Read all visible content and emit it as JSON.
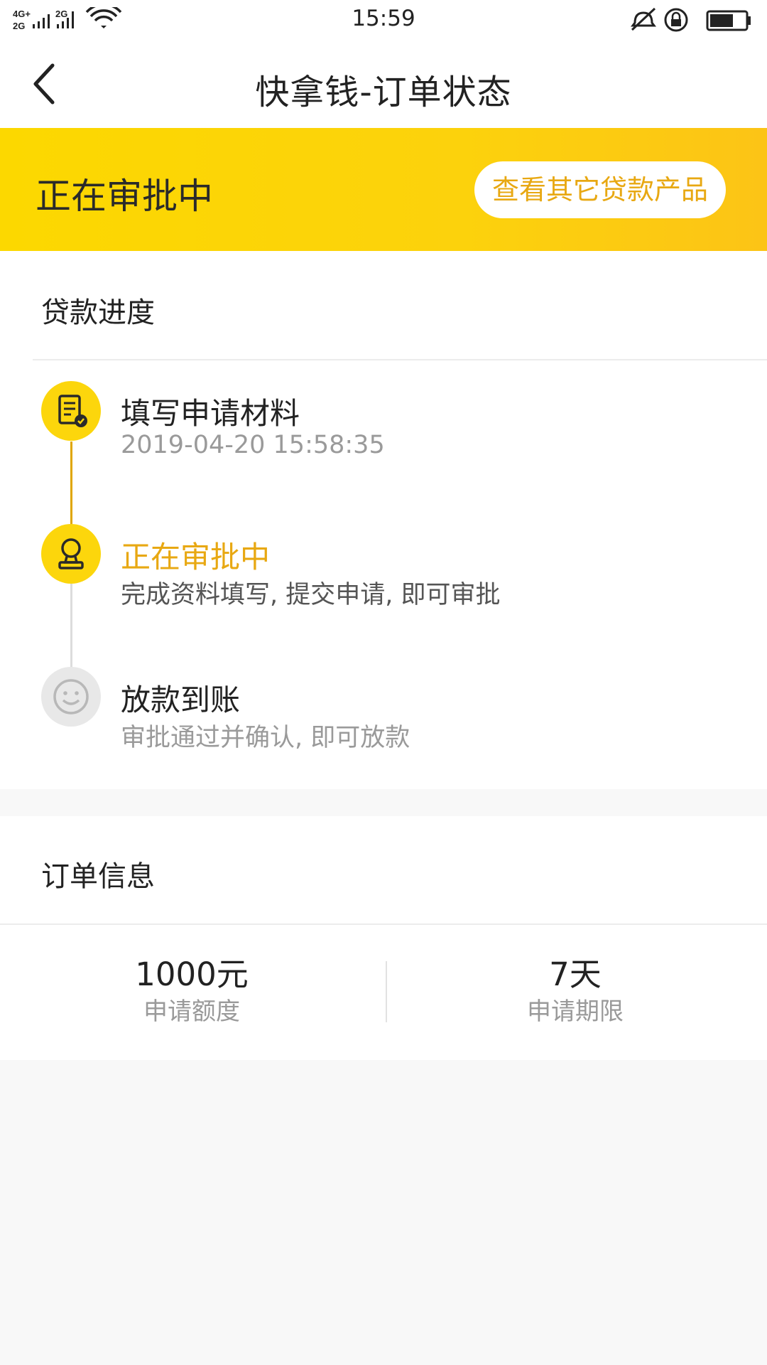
{
  "status_bar": {
    "network_top": "4G",
    "network_bottom": "2G",
    "network2": "2G",
    "time": "15:59",
    "icons": [
      "signal-icon",
      "wifi-icon",
      "mute-icon",
      "rotation-lock-icon",
      "battery-icon"
    ]
  },
  "nav": {
    "title": "快拿钱-订单状态",
    "back_icon": "chevron-left-icon"
  },
  "banner": {
    "status": "正在审批中",
    "button_label": "查看其它贷款产品"
  },
  "progress": {
    "section_title": "贷款进度",
    "steps": [
      {
        "title": "填写申请材料",
        "subtitle": "2019-04-20 15:58:35",
        "icon": "document-check-icon",
        "state": "done"
      },
      {
        "title": "正在审批中",
        "subtitle": "完成资料填写, 提交申请, 即可审批",
        "icon": "stamp-icon",
        "state": "current"
      },
      {
        "title": "放款到账",
        "subtitle": "审批通过并确认, 即可放款",
        "icon": "smiley-icon",
        "state": "pending"
      }
    ]
  },
  "order": {
    "section_title": "订单信息",
    "amount_value": "1000元",
    "amount_label": "申请额度",
    "term_value": "7天",
    "term_label": "申请期限"
  },
  "colors": {
    "accent_yellow": "#fcd60c",
    "accent_orange_text": "#e8a812",
    "timeline_done": "#e0a600",
    "timeline_pending": "#dcdcdc"
  }
}
